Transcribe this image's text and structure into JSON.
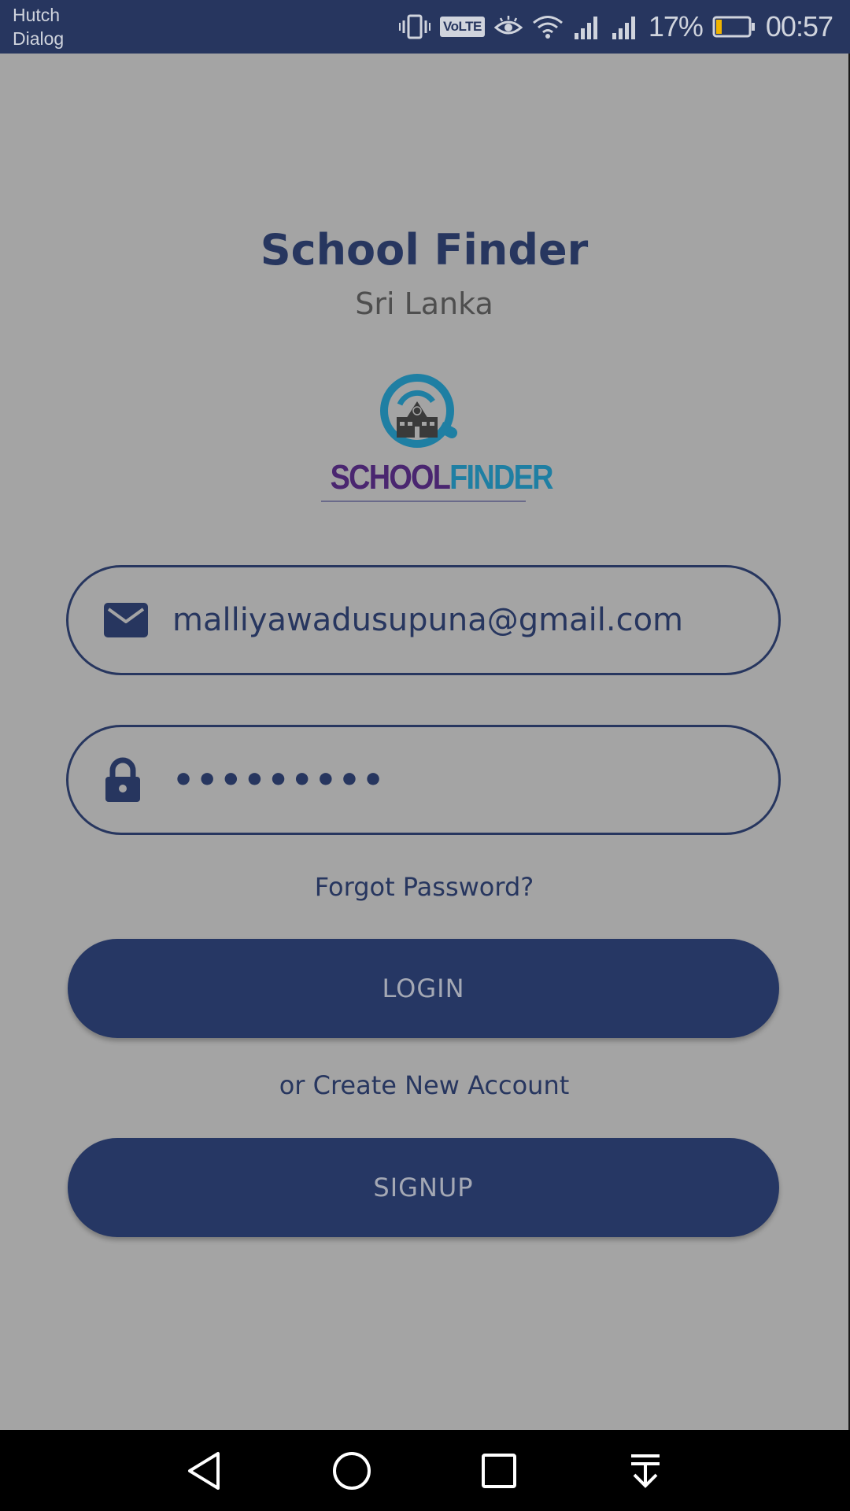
{
  "status_bar": {
    "carrier_1": "Hutch",
    "carrier_2": "Dialog",
    "volte": "VoLTE",
    "battery_percent": "17%",
    "time": "00:57",
    "icons": [
      "vibrate-icon",
      "volte-icon",
      "eye-comfort-icon",
      "wifi-icon",
      "signal-icon",
      "signal-icon",
      "battery-icon"
    ],
    "battery_level": 0.17
  },
  "app": {
    "title": "School Finder",
    "subtitle": "Sri Lanka",
    "logo": {
      "text_part_1": "SCHOOL",
      "text_part_2": "FINDER"
    }
  },
  "login_form": {
    "email": {
      "icon": "envelope-icon",
      "value": "malliyawadusupuna@gmail.com"
    },
    "password": {
      "icon": "lock-icon",
      "value": "•••••••••"
    },
    "forgot_password": "Forgot Password?",
    "login_button": "LOGIN",
    "create_account_text": "or Create New Account",
    "signup_button": "SIGNUP"
  },
  "nav_bar": {
    "buttons": [
      "back-icon",
      "home-icon",
      "recents-icon",
      "notification-pull-icon"
    ]
  },
  "colors": {
    "status_bar": "#27365f",
    "background": "#a4a4a4",
    "primary": "#27365f",
    "button": "#263764",
    "logo_purple": "#4a2670",
    "logo_blue": "#1f7fa3",
    "battery_fill": "#f0b400"
  }
}
